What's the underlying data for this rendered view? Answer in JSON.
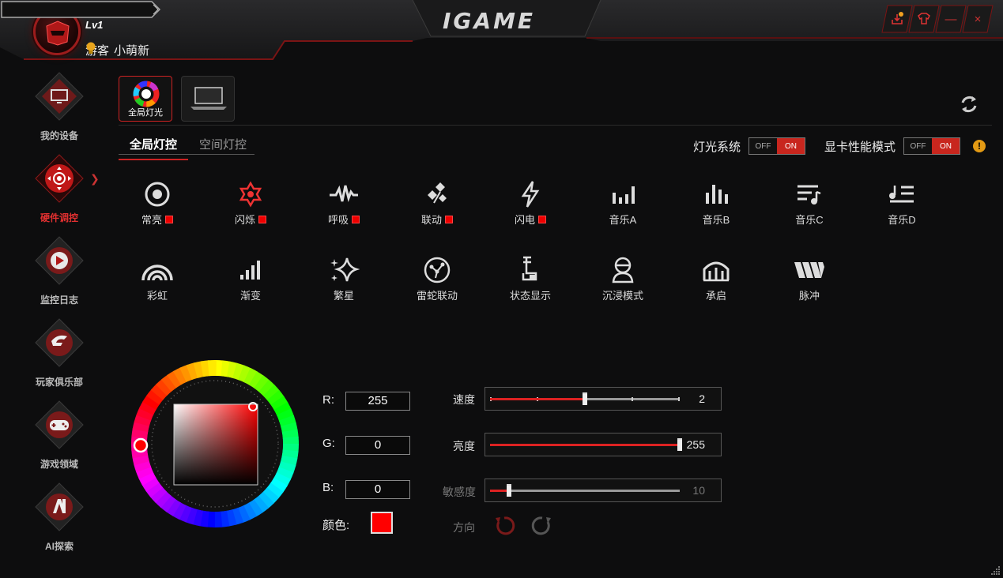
{
  "header": {
    "level": "Lv1",
    "user_type": "游客",
    "username": "小萌新",
    "logo": "IGAME"
  },
  "window_buttons": [
    {
      "icon": "download-update-icon"
    },
    {
      "icon": "skin-icon"
    },
    {
      "icon": "minimize-icon",
      "label": "—"
    },
    {
      "icon": "close-icon",
      "label": "×"
    }
  ],
  "sidebar": {
    "items": [
      {
        "label": "我的设备",
        "icon": "monitor-icon"
      },
      {
        "label": "硬件调控",
        "icon": "dpad-icon",
        "active": true
      },
      {
        "label": "监控日志",
        "icon": "speedometer-icon"
      },
      {
        "label": "玩家俱乐部",
        "icon": "igame-club-icon"
      },
      {
        "label": "游戏领域",
        "icon": "gamepad-icon"
      },
      {
        "label": "AI探索",
        "icon": "ai-icon"
      }
    ]
  },
  "device_tiles": [
    {
      "label": "全局灯光",
      "icon": "rgb-ring-icon",
      "active": true
    },
    {
      "label": "",
      "icon": "laptop-icon",
      "active": false
    }
  ],
  "tabs": [
    {
      "label": "全局灯控",
      "active": true
    },
    {
      "label": "空间灯控",
      "active": false
    }
  ],
  "toggles": {
    "light_system": {
      "label": "灯光系统",
      "off": "OFF",
      "on": "ON",
      "state": "ON"
    },
    "gpu_mode": {
      "label": "显卡性能模式",
      "off": "OFF",
      "on": "ON",
      "state": "ON"
    },
    "warn": "!"
  },
  "effects_row1": [
    {
      "label": "常亮",
      "icon": "steady-icon",
      "swatch": true
    },
    {
      "label": "闪烁",
      "icon": "flash-icon",
      "swatch": true
    },
    {
      "label": "呼吸",
      "icon": "breath-icon",
      "swatch": true
    },
    {
      "label": "联动",
      "icon": "link-icon",
      "swatch": true
    },
    {
      "label": "闪电",
      "icon": "lightning-icon",
      "swatch": true
    },
    {
      "label": "音乐A",
      "icon": "music-a-icon",
      "swatch": false
    },
    {
      "label": "音乐B",
      "icon": "music-b-icon",
      "swatch": false
    },
    {
      "label": "音乐C",
      "icon": "music-c-icon",
      "swatch": false
    },
    {
      "label": "音乐D",
      "icon": "music-d-icon",
      "swatch": false
    }
  ],
  "effects_row2": [
    {
      "label": "彩虹",
      "icon": "rainbow-icon"
    },
    {
      "label": "渐变",
      "icon": "gradient-icon"
    },
    {
      "label": "繁星",
      "icon": "stars-icon"
    },
    {
      "label": "雷蛇联动",
      "icon": "razer-icon"
    },
    {
      "label": "状态显示",
      "icon": "status-icon"
    },
    {
      "label": "沉浸模式",
      "icon": "immersive-icon"
    },
    {
      "label": "承启",
      "icon": "bridge-icon"
    },
    {
      "label": "脉冲",
      "icon": "pulse-icon"
    }
  ],
  "color": {
    "r_label": "R:",
    "r": "255",
    "g_label": "G:",
    "g": "0",
    "b_label": "B:",
    "b": "0",
    "swatch_label": "颜色:",
    "swatch_color": "#ff0000"
  },
  "sliders": {
    "speed": {
      "label": "速度",
      "value": "2",
      "max": 4
    },
    "brightness": {
      "label": "亮度",
      "value": "255",
      "max": 255
    },
    "sensitivity": {
      "label": "敏感度",
      "value": "10",
      "max": 100
    },
    "direction_label": "方向"
  },
  "colors": {
    "accent": "#c8261e",
    "bg": "#0d0d0e"
  }
}
